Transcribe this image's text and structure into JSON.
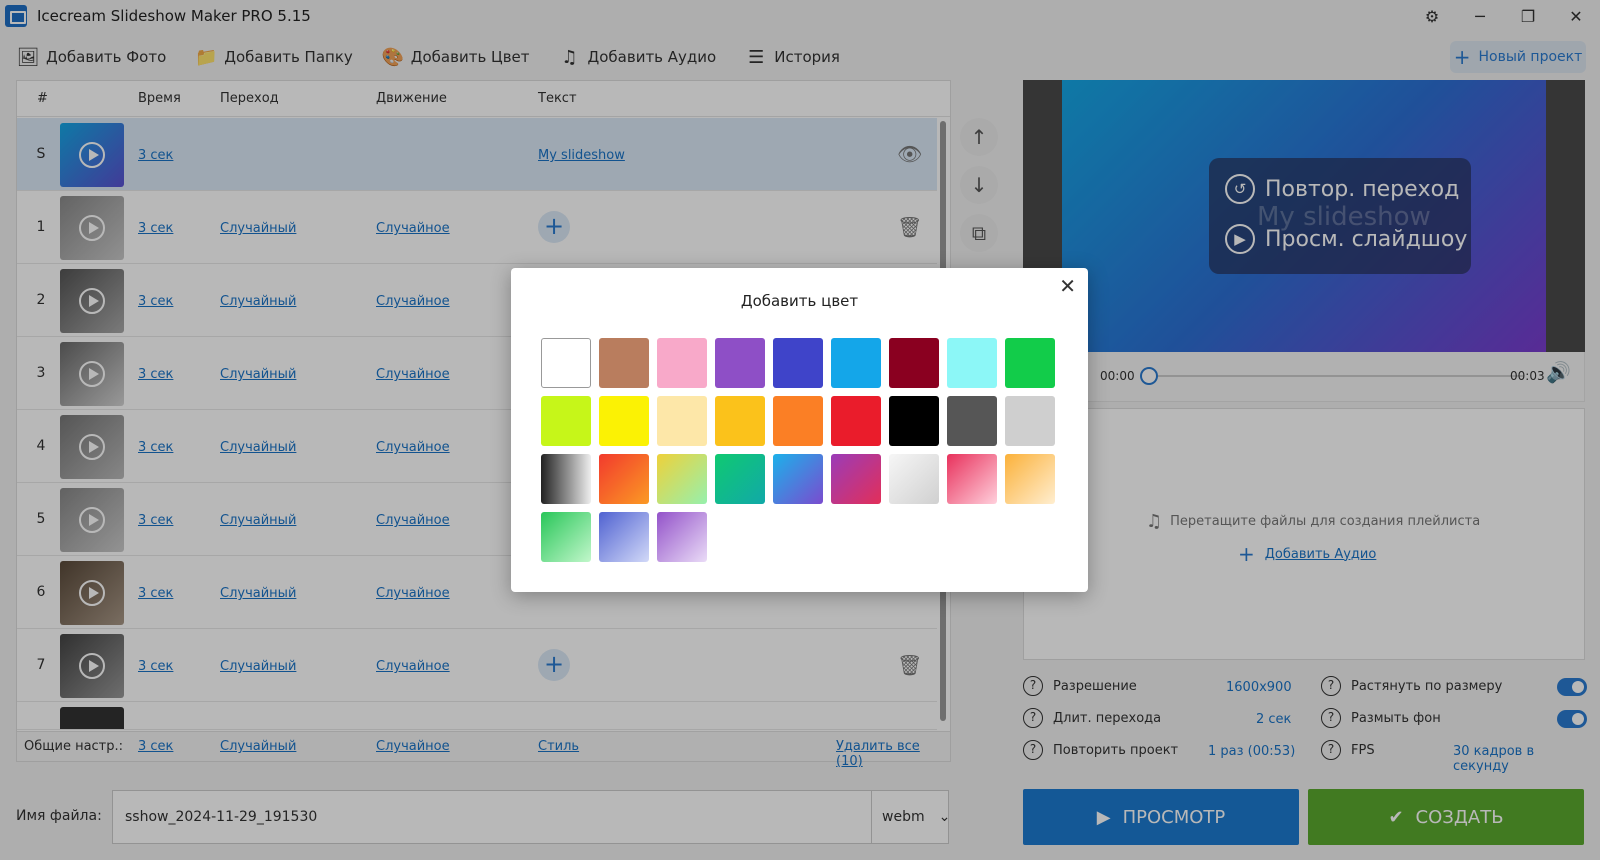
{
  "window": {
    "title": "Icecream Slideshow Maker PRO 5.15"
  },
  "toolbar": {
    "add_photo": "Добавить Фото",
    "add_folder": "Добавить Папку",
    "add_color": "Добавить Цвет",
    "add_audio": "Добавить Аудио",
    "history": "История",
    "new_project": "Новый проект"
  },
  "list": {
    "headers": {
      "num": "#",
      "time": "Время",
      "transition": "Переход",
      "motion": "Движение",
      "text": "Текст"
    },
    "rows": [
      {
        "num": "S",
        "time": "3 сек",
        "transition": "",
        "motion": "",
        "text": "My slideshow"
      },
      {
        "num": "1",
        "time": "3 сек",
        "transition": "Случайный",
        "motion": "Случайное"
      },
      {
        "num": "2",
        "time": "3 сек",
        "transition": "Случайный",
        "motion": "Случайное"
      },
      {
        "num": "3",
        "time": "3 сек",
        "transition": "Случайный",
        "motion": "Случайное"
      },
      {
        "num": "4",
        "time": "3 сек",
        "transition": "Случайный",
        "motion": "Случайное"
      },
      {
        "num": "5",
        "time": "3 сек",
        "transition": "Случайный",
        "motion": "Случайное"
      },
      {
        "num": "6",
        "time": "3 сек",
        "transition": "Случайный",
        "motion": "Случайное"
      },
      {
        "num": "7",
        "time": "3 сек",
        "transition": "Случайный",
        "motion": "Случайное"
      }
    ],
    "footer": {
      "label": "Общие настр.:",
      "time": "3 сек",
      "transition": "Случайный",
      "motion": "Случайное",
      "style": "Стиль",
      "delete_all": "Удалить все (10)"
    }
  },
  "preview": {
    "replay": "Повтор. переход",
    "ghost_text": "My slideshow",
    "play": "Просм. слайдшоу",
    "time_start": "00:00",
    "time_end": "00:03",
    "progress": 0
  },
  "audio": {
    "hint": "Перетащите файлы для создания плейлиста",
    "add": "Добавить Аудио"
  },
  "settings": {
    "resolution_label": "Разрешение",
    "resolution": "1600x900",
    "transition_len_label": "Длит. перехода",
    "transition_len": "2 сек",
    "repeat_label": "Повторить проект",
    "repeat": "1 раз (00:53)",
    "stretch_label": "Растянуть по размеру",
    "blur_label": "Размыть фон",
    "fps_label": "FPS",
    "fps": "30 кадров в секунду"
  },
  "file": {
    "label": "Имя файла:",
    "name": "sshow_2024-11-29_191530",
    "format": "webm"
  },
  "buttons": {
    "preview": "ПРОСМОТР",
    "create": "СОЗДАТЬ"
  },
  "dialog": {
    "title": "Добавить цвет",
    "swatches": [
      "#ffffff",
      "#b97d5e",
      "#f8a9c9",
      "#8e4fc6",
      "#3f44c9",
      "#14a6e9",
      "#8a0020",
      "#8cf7f7",
      "#12cc4a",
      "#c6f619",
      "#fbf204",
      "#fde7a8",
      "#fbc21b",
      "#fb7f25",
      "#ea1c2b",
      "#000000",
      "#565656",
      "#cfcfcf",
      "linear-gradient(90deg,#222,#eee)",
      "linear-gradient(135deg,#f23a2d,#fb9a24)",
      "linear-gradient(135deg,#eed13a,#96f0ad)",
      "linear-gradient(135deg,#10c971,#11a9a8)",
      "linear-gradient(135deg,#1cb1ea,#7a4ccf)",
      "linear-gradient(135deg,#9a3cb8,#e22f59)",
      "linear-gradient(135deg,#f6f6f6,#d0d0d0)",
      "linear-gradient(135deg,#e8315c,#ffd0dc)",
      "linear-gradient(135deg,#fbb13a,#ffeed0)",
      "linear-gradient(135deg,#29c659,#c2f7cb)",
      "linear-gradient(135deg,#5062d1,#d2d9f8)",
      "linear-gradient(135deg,#9352c9,#eadcf7)"
    ]
  }
}
